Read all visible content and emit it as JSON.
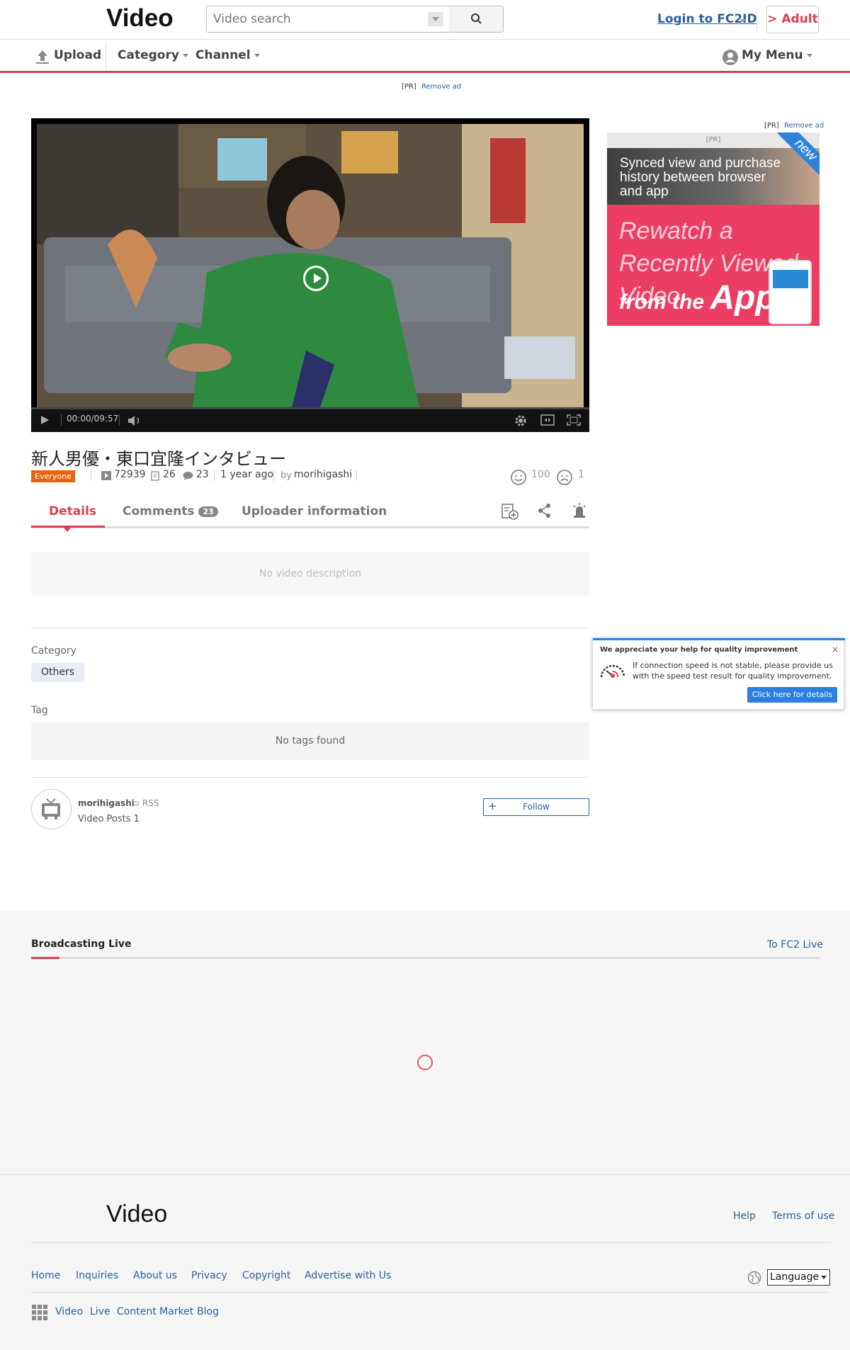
{
  "header": {
    "logo": "Video",
    "search_placeholder": "Video search",
    "login": "Login to FC2ID",
    "adult": "> Adult"
  },
  "nav": {
    "upload": "Upload",
    "category": "Category",
    "channel": "Channel",
    "my_menu": "My Menu"
  },
  "top_ad": {
    "pr": "[PR]",
    "remove": "Remove ad"
  },
  "player": {
    "time": "00:00/09:57"
  },
  "video": {
    "title": "新人男優・東口宜隆インタビュー",
    "rating": "Everyone",
    "views": "72939",
    "favorites": "26",
    "comments": "23",
    "posted": "1 year ago",
    "by": "by",
    "uploader": "morihigashi",
    "likes": "100",
    "dislikes": "1"
  },
  "tabs": {
    "details": "Details",
    "comments": "Comments",
    "comments_count": "23",
    "uploader": "Uploader information"
  },
  "details": {
    "description": "No video description",
    "category_label": "Category",
    "category_value": "Others",
    "tag_label": "Tag",
    "tags_empty": "No tags found"
  },
  "uploader_box": {
    "name": "morihigashi",
    "rss": "RSS",
    "posts": "Video Posts 1",
    "follow": "Follow"
  },
  "sidebar_ad": {
    "pr": "[PR]",
    "remove": "Remove ad",
    "inner_pr": "[PR]",
    "synced": "Synced view and purchase history between browser and app",
    "new": "new",
    "rewatch": "Rewatch a Recently Viewed Video",
    "from": "from the",
    "app": "App"
  },
  "notice": {
    "title": "We appreciate your help for quality improvement",
    "close": "×",
    "text": "If connection speed is not stable, please provide us with the speed test result for quality improvement.",
    "button": "Click here for details"
  },
  "live": {
    "title": "Broadcasting Live",
    "link": "To FC2 Live"
  },
  "footer": {
    "logo": "Video",
    "help": "Help",
    "terms": "Terms of use",
    "links": [
      "Home",
      "Inquiries",
      "About us",
      "Privacy",
      "Copyright",
      "Advertise with Us"
    ],
    "language": "Language",
    "services": [
      "Video",
      "Live",
      "Content Market",
      "Blog"
    ]
  },
  "colors": {
    "accent": "#d9434f",
    "link": "#2a5e9f",
    "rating_badge": "#e8650d",
    "notice_blue": "#2a80e0"
  }
}
